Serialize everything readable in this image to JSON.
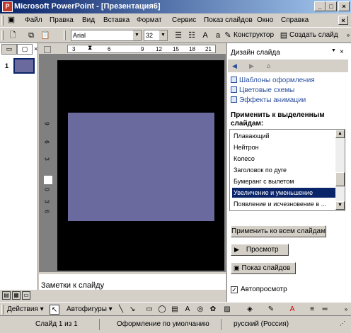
{
  "title": "Microsoft PowerPoint - [Презентация6]",
  "menu": [
    "Файл",
    "Правка",
    "Вид",
    "Вставка",
    "Формат",
    "Сервис",
    "Показ слайдов",
    "Окно",
    "Справка"
  ],
  "toolbar": {
    "font_name": "Arial",
    "font_size": "32",
    "designer_label": "Конструктор",
    "new_slide_label": "Создать слайд"
  },
  "slides_panel": {
    "slide_number": "1"
  },
  "ruler": {
    "ticks": [
      "3",
      "6",
      "9",
      "12",
      "15",
      "18",
      "21"
    ],
    "vticks": [
      "9",
      "6",
      "3",
      "0",
      "3",
      "6"
    ]
  },
  "notes_placeholder": "Заметки к слайду",
  "task_pane": {
    "title": "Дизайн слайда",
    "links": [
      "Шаблоны оформления",
      "Цветовые схемы",
      "Эффекты анимации"
    ],
    "apply_header": "Применить к выделенным слайдам:",
    "animations": [
      "Плавающий",
      "Нейтрон",
      "Колесо",
      "Заголовок по дуге",
      "Бумеранг с вылетом",
      "Увеличение и уменьшение",
      "Появление и исчезновение в ..."
    ],
    "selected_index": 5,
    "apply_all_button": "Применить ко всем слайдам",
    "preview_button": "Просмотр",
    "slideshow_button": "Показ слайдов",
    "autopreview_label": "Автопросмотр",
    "autopreview_checked": true
  },
  "drawbar": {
    "actions_label": "Действия",
    "autoshapes_label": "Автофигуры"
  },
  "status": {
    "slide": "Слайд 1 из 1",
    "design": "Оформление по умолчанию",
    "language": "русский (Россия)"
  },
  "colors": {
    "titlebar": "#0a246a",
    "slide_bg": "#000000",
    "shape_fill": "#6a6a9e",
    "link": "#2a4e9c"
  }
}
